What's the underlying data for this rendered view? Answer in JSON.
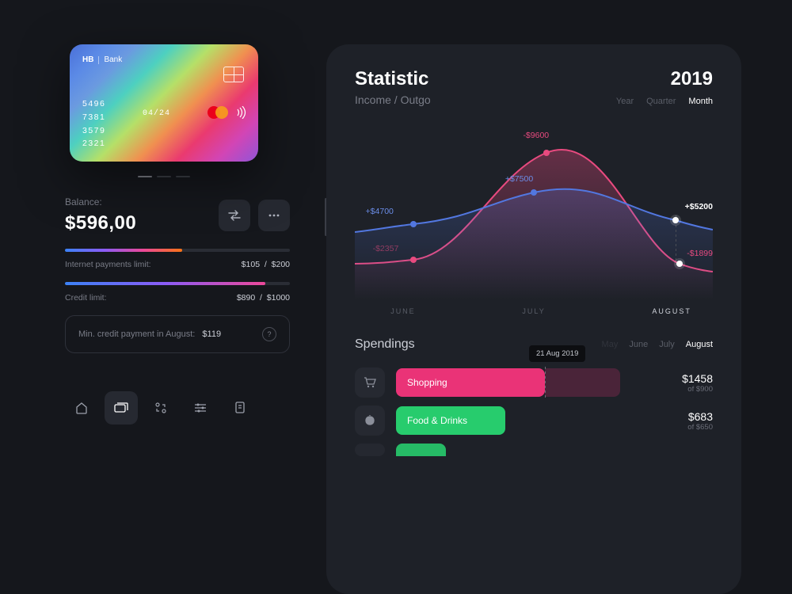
{
  "card": {
    "bank_logo": "HB",
    "bank_name": "Bank",
    "number_l1": "5496",
    "number_l2": "7381",
    "number_l3": "3579",
    "number_l4": "2321",
    "expiry": "04/24"
  },
  "balance": {
    "label": "Balance:",
    "value": "$596,00"
  },
  "limits": {
    "internet": {
      "label": "Internet payments limit:",
      "used": "$105",
      "sep": "/",
      "total": "$200"
    },
    "credit": {
      "label": "Credit limit:",
      "used": "$890",
      "sep": "/",
      "total": "$1000"
    }
  },
  "min_payment": {
    "label": "Min. credit payment in August:",
    "value": "$119"
  },
  "statistic": {
    "title": "Statistic",
    "subtitle": "Income / Outgo",
    "year": "2019",
    "tabs": [
      "Year",
      "Quarter",
      "Month"
    ],
    "axis": [
      "JUNE",
      "JULY",
      "AUGUST"
    ]
  },
  "spendings": {
    "title": "Spendings",
    "months": [
      "May",
      "June",
      "July",
      "August"
    ],
    "date_badge": "21 Aug 2019",
    "items": [
      {
        "label": "Shopping",
        "value": "$1458",
        "of": "of $900"
      },
      {
        "label": "Food & Drinks",
        "value": "$683",
        "of": "of $650"
      }
    ]
  },
  "chart_data": {
    "type": "line",
    "title": "Statistic — Income / Outgo",
    "xlabel": "",
    "ylabel": "$",
    "categories": [
      "June",
      "July",
      "August"
    ],
    "series": [
      {
        "name": "Income",
        "values": [
          4700,
          7500,
          5200
        ],
        "labels": [
          "+$4700",
          "+$7500",
          "+$5200"
        ]
      },
      {
        "name": "Outgo",
        "values": [
          -2357,
          -9600,
          -1899
        ],
        "labels": [
          "-$2357",
          "-$9600",
          "-$1899"
        ]
      }
    ],
    "ylim": [
      -10000,
      10000
    ],
    "highlight_category": "August"
  }
}
